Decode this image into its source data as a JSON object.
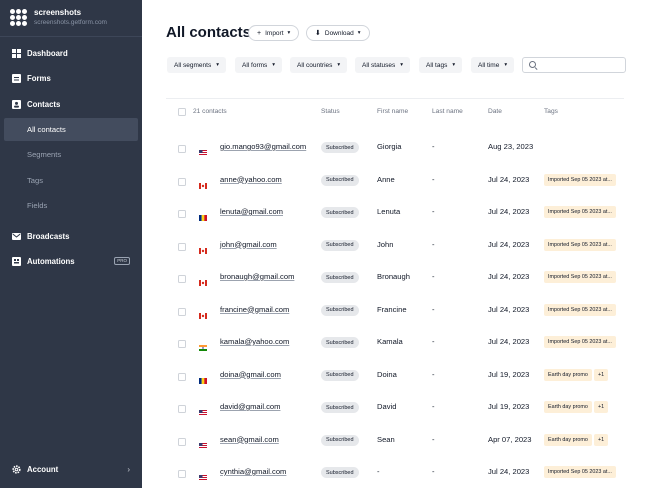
{
  "brand": {
    "name": "screenshots",
    "url": "screenshots.getform.com"
  },
  "nav": {
    "forms_title": "Forms",
    "dashboard": "Dashboard",
    "contacts": "Contacts",
    "sub": [
      "All contacts",
      "Segments",
      "Tags",
      "Fields"
    ],
    "broadcasts": "Broadcasts",
    "automations": "Automations",
    "pro_badge": "PRO",
    "account": "Account"
  },
  "page": {
    "title": "All contacts",
    "import": "Import",
    "download": "Download"
  },
  "filters": [
    "All segments",
    "All forms",
    "All countries",
    "All statuses",
    "All tags",
    "All time"
  ],
  "search": {
    "placeholder": ""
  },
  "table": {
    "count": "21 contacts",
    "headers": {
      "status": "Status",
      "first": "First name",
      "last": "Last name",
      "date": "Date",
      "tags": "Tags"
    },
    "rows": [
      {
        "email": "gio.mango93@gmail.com",
        "flag": "us",
        "status": "Subscribed",
        "first": "Giorgia",
        "last": "-",
        "date": "Aug 23, 2023",
        "tags": []
      },
      {
        "email": "anne@yahoo.com",
        "flag": "ca",
        "status": "Subscribed",
        "first": "Anne",
        "last": "-",
        "date": "Jul 24, 2023",
        "tags": [
          "Imported Sep 05 2023 at..."
        ]
      },
      {
        "email": "lenuta@gmail.com",
        "flag": "ro",
        "status": "Subscribed",
        "first": "Lenuta",
        "last": "-",
        "date": "Jul 24, 2023",
        "tags": [
          "Imported Sep 05 2023 at..."
        ]
      },
      {
        "email": "john@gmail.com",
        "flag": "ca",
        "status": "Subscribed",
        "first": "John",
        "last": "-",
        "date": "Jul 24, 2023",
        "tags": [
          "Imported Sep 05 2023 at..."
        ]
      },
      {
        "email": "bronaugh@gmail.com",
        "flag": "ca",
        "status": "Subscribed",
        "first": "Bronaugh",
        "last": "-",
        "date": "Jul 24, 2023",
        "tags": [
          "Imported Sep 05 2023 at..."
        ]
      },
      {
        "email": "francine@gmail.com",
        "flag": "ca",
        "status": "Subscribed",
        "first": "Francine",
        "last": "-",
        "date": "Jul 24, 2023",
        "tags": [
          "Imported Sep 05 2023 at..."
        ]
      },
      {
        "email": "kamala@yahoo.com",
        "flag": "in",
        "status": "Subscribed",
        "first": "Kamala",
        "last": "-",
        "date": "Jul 24, 2023",
        "tags": [
          "Imported Sep 05 2023 at..."
        ]
      },
      {
        "email": "doina@gmail.com",
        "flag": "ro",
        "status": "Subscribed",
        "first": "Doina",
        "last": "-",
        "date": "Jul 19, 2023",
        "tags": [
          "Earth day promo",
          "+1"
        ]
      },
      {
        "email": "david@gmail.com",
        "flag": "us",
        "status": "Subscribed",
        "first": "David",
        "last": "-",
        "date": "Jul 19, 2023",
        "tags": [
          "Earth day promo",
          "+1"
        ]
      },
      {
        "email": "sean@gmail.com",
        "flag": "us",
        "status": "Subscribed",
        "first": "Sean",
        "last": "-",
        "date": "Apr 07, 2023",
        "tags": [
          "Earth day promo",
          "+1"
        ]
      },
      {
        "email": "cynthia@gmail.com",
        "flag": "us",
        "status": "Subscribed",
        "first": "-",
        "last": "-",
        "date": "Jul 24, 2023",
        "tags": [
          "Imported Sep 05 2023 at..."
        ]
      }
    ]
  },
  "colors": {
    "sidebar": "#2f3747",
    "active": "#434c5e",
    "tag": "#fdefd8",
    "badge": "#e6e8eb"
  }
}
